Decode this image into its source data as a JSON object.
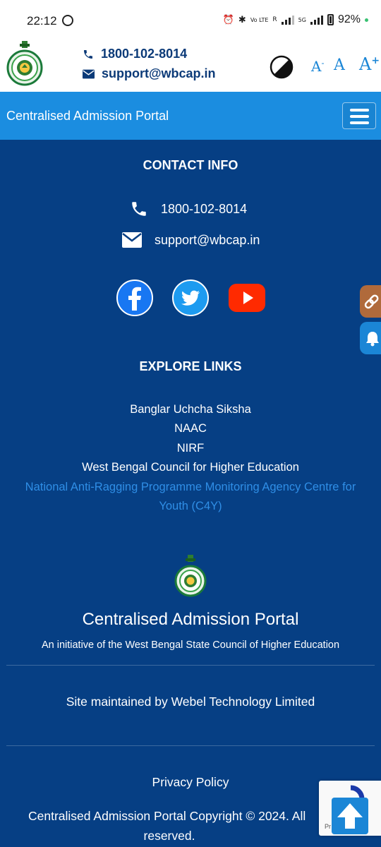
{
  "status_bar": {
    "time": "22:12",
    "battery": "92%",
    "network": "5G",
    "volte": "Vo LTE",
    "signal_r": "R"
  },
  "header": {
    "phone": "1800-102-8014",
    "email": "support@wbcap.in",
    "font_small": "A",
    "font_normal": "A",
    "font_large": "A",
    "font_small_sup": "-",
    "font_large_sup": "+"
  },
  "navbar": {
    "brand": "Centralised Admission Portal"
  },
  "contact_info": {
    "heading": "CONTACT INFO",
    "phone": "1800-102-8014",
    "email": "support@wbcap.in"
  },
  "explore_links": {
    "heading": "EXPLORE LINKS",
    "links": [
      "Banglar Uchcha Siksha",
      "NAAC",
      "NIRF",
      "West Bengal Council for Higher Education",
      "National Anti-Ragging Programme Monitoring Agency Centre for",
      "Youth (C4Y)"
    ]
  },
  "footer": {
    "title": "Centralised Admission Portal",
    "subtitle": "An initiative of the West Bengal State Council of Higher Education",
    "maintained": "Site maintained by Webel Technology Limited",
    "privacy": "Privacy Policy",
    "copyright_line1": "Centralised Admission Portal Copyright © 2024. All",
    "copyright_line2": "reserved.",
    "recaptcha_text": "Pr          ns"
  },
  "colors": {
    "footer_bg": "#063f84",
    "navbar_bg": "#1b8de0",
    "accent": "#1b86d6",
    "link_highlight": "#2f8ee6",
    "facebook": "#1877f2",
    "twitter": "#1d9bf0",
    "youtube": "#ff0000",
    "link_tab": "#b06a3b",
    "bell_tab": "#1b86d6"
  }
}
